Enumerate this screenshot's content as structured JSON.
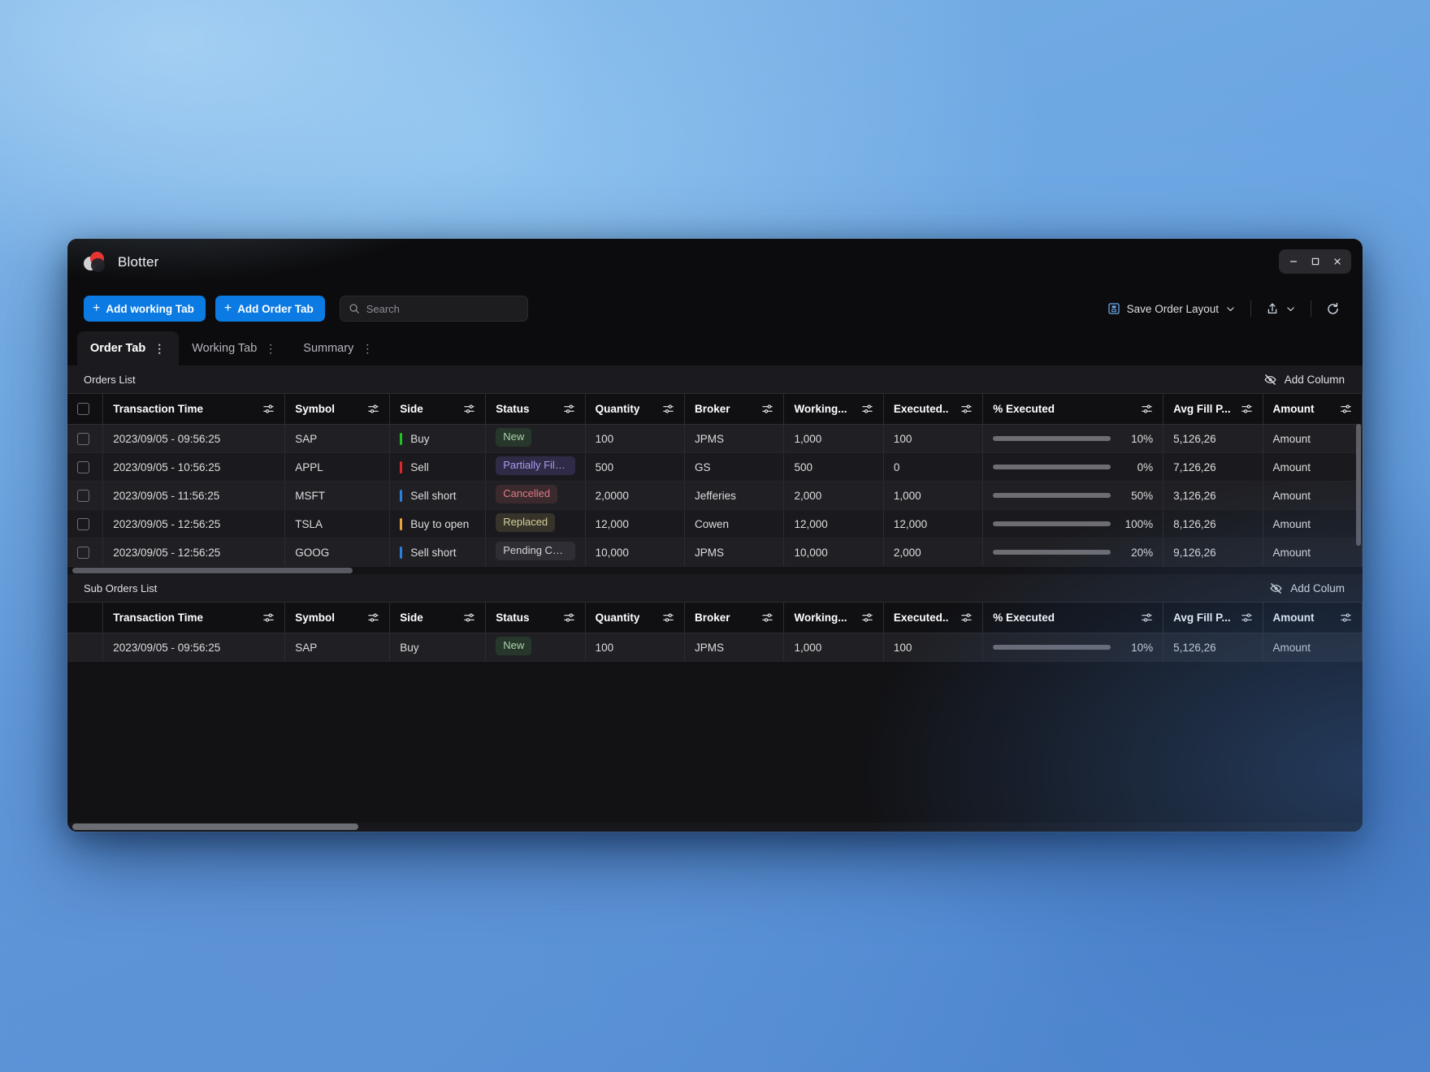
{
  "window": {
    "app_title": "Blotter",
    "controls": {
      "minimize": "–",
      "maximize": "□",
      "close": "✕"
    }
  },
  "toolbar": {
    "add_working_tab": "Add working Tab",
    "add_order_tab": "Add Order Tab",
    "plus": "+",
    "search_placeholder": "Search",
    "search_value": "",
    "save_order_layout": "Save Order Layout",
    "share_label": "",
    "refresh_label": ""
  },
  "tabs": [
    {
      "label": "Order Tab",
      "active": true
    },
    {
      "label": "Working Tab",
      "active": false
    },
    {
      "label": "Summary",
      "active": false
    }
  ],
  "orders_section": {
    "title": "Orders List",
    "add_column": "Add Column"
  },
  "sub_orders_section": {
    "title": "Sub Orders List",
    "add_column": "Add Colum"
  },
  "columns": [
    {
      "key": "time",
      "label": "Transaction Time"
    },
    {
      "key": "symbol",
      "label": "Symbol"
    },
    {
      "key": "side",
      "label": "Side"
    },
    {
      "key": "status",
      "label": "Status"
    },
    {
      "key": "qty",
      "label": "Quantity"
    },
    {
      "key": "broker",
      "label": "Broker"
    },
    {
      "key": "working",
      "label": "Working..."
    },
    {
      "key": "exec",
      "label": "Executed.."
    },
    {
      "key": "pct",
      "label": "% Executed"
    },
    {
      "key": "avg",
      "label": "Avg Fill P..."
    },
    {
      "key": "amount",
      "label": "Amount"
    }
  ],
  "orders": [
    {
      "time": "2023/09/05 - 09:56:25",
      "symbol": "SAP",
      "side": "Buy",
      "side_color": "#1fc61f",
      "status": "New",
      "status_color": "#a8d6a8",
      "status_bg": "#27372b",
      "qty": "100",
      "broker": "JPMS",
      "working": "1,000",
      "exec": "100",
      "pct": "10%",
      "pct_fill": 55,
      "avg": "5,126,26",
      "amount": "Amount"
    },
    {
      "time": "2023/09/05 - 10:56:25",
      "symbol": "APPL",
      "side": "Sell",
      "side_color": "#e0262b",
      "status": "Partially Filled",
      "status_color": "#a79cf0",
      "status_bg": "#2f2b46",
      "qty": "500",
      "broker": "GS",
      "working": "500",
      "exec": "0",
      "pct": "0%",
      "pct_fill": 55,
      "avg": "7,126,26",
      "amount": "Amount"
    },
    {
      "time": "2023/09/05 - 11:56:25",
      "symbol": "MSFT",
      "side": "Sell short",
      "side_color": "#2a7fdd",
      "status": "Cancelled",
      "status_color": "#e07a88",
      "status_bg": "#3a2a2d",
      "qty": "2,0000",
      "broker": "Jefferies",
      "working": "2,000",
      "exec": "1,000",
      "pct": "50%",
      "pct_fill": 55,
      "avg": "3,126,26",
      "amount": "Amount"
    },
    {
      "time": "2023/09/05 - 12:56:25",
      "symbol": "TSLA",
      "side": "Buy to open",
      "side_color": "#e8a33a",
      "status": "Replaced",
      "status_color": "#d4cf9a",
      "status_bg": "#36342a",
      "qty": "12,000",
      "broker": "Cowen",
      "working": "12,000",
      "exec": "12,000",
      "pct": "100%",
      "pct_fill": 55,
      "avg": "8,126,26",
      "amount": "Amount"
    },
    {
      "time": "2023/09/05 - 12:56:25",
      "symbol": "GOOG",
      "side": "Sell short",
      "side_color": "#2a7fdd",
      "status": "Pending Canc...",
      "status_color": "#d6d6da",
      "status_bg": "#2e2e34",
      "qty": "10,000",
      "broker": "JPMS",
      "working": "10,000",
      "exec": "2,000",
      "pct": "20%",
      "pct_fill": 55,
      "avg": "9,126,26",
      "amount": "Amount"
    }
  ],
  "sub_orders": [
    {
      "time": "2023/09/05 - 09:56:25",
      "symbol": "SAP",
      "side": "Buy",
      "side_color": "",
      "status": "New",
      "status_color": "#a8d6a8",
      "status_bg": "#27372b",
      "qty": "100",
      "broker": "JPMS",
      "working": "1,000",
      "exec": "100",
      "pct": "10%",
      "pct_fill": 55,
      "avg": "5,126,26",
      "amount": "Amount"
    }
  ],
  "icons": {
    "filter": "column-filter-icon",
    "search": "search-icon",
    "save": "save-disk-icon",
    "share": "share-upload-icon",
    "refresh": "refresh-icon",
    "hide": "eye-off-icon",
    "chevron": "chevron-down-icon",
    "kebab": "kebab-menu-icon"
  },
  "accent": {
    "primary": "#0b7ae3",
    "progress": "#1ec51e"
  }
}
